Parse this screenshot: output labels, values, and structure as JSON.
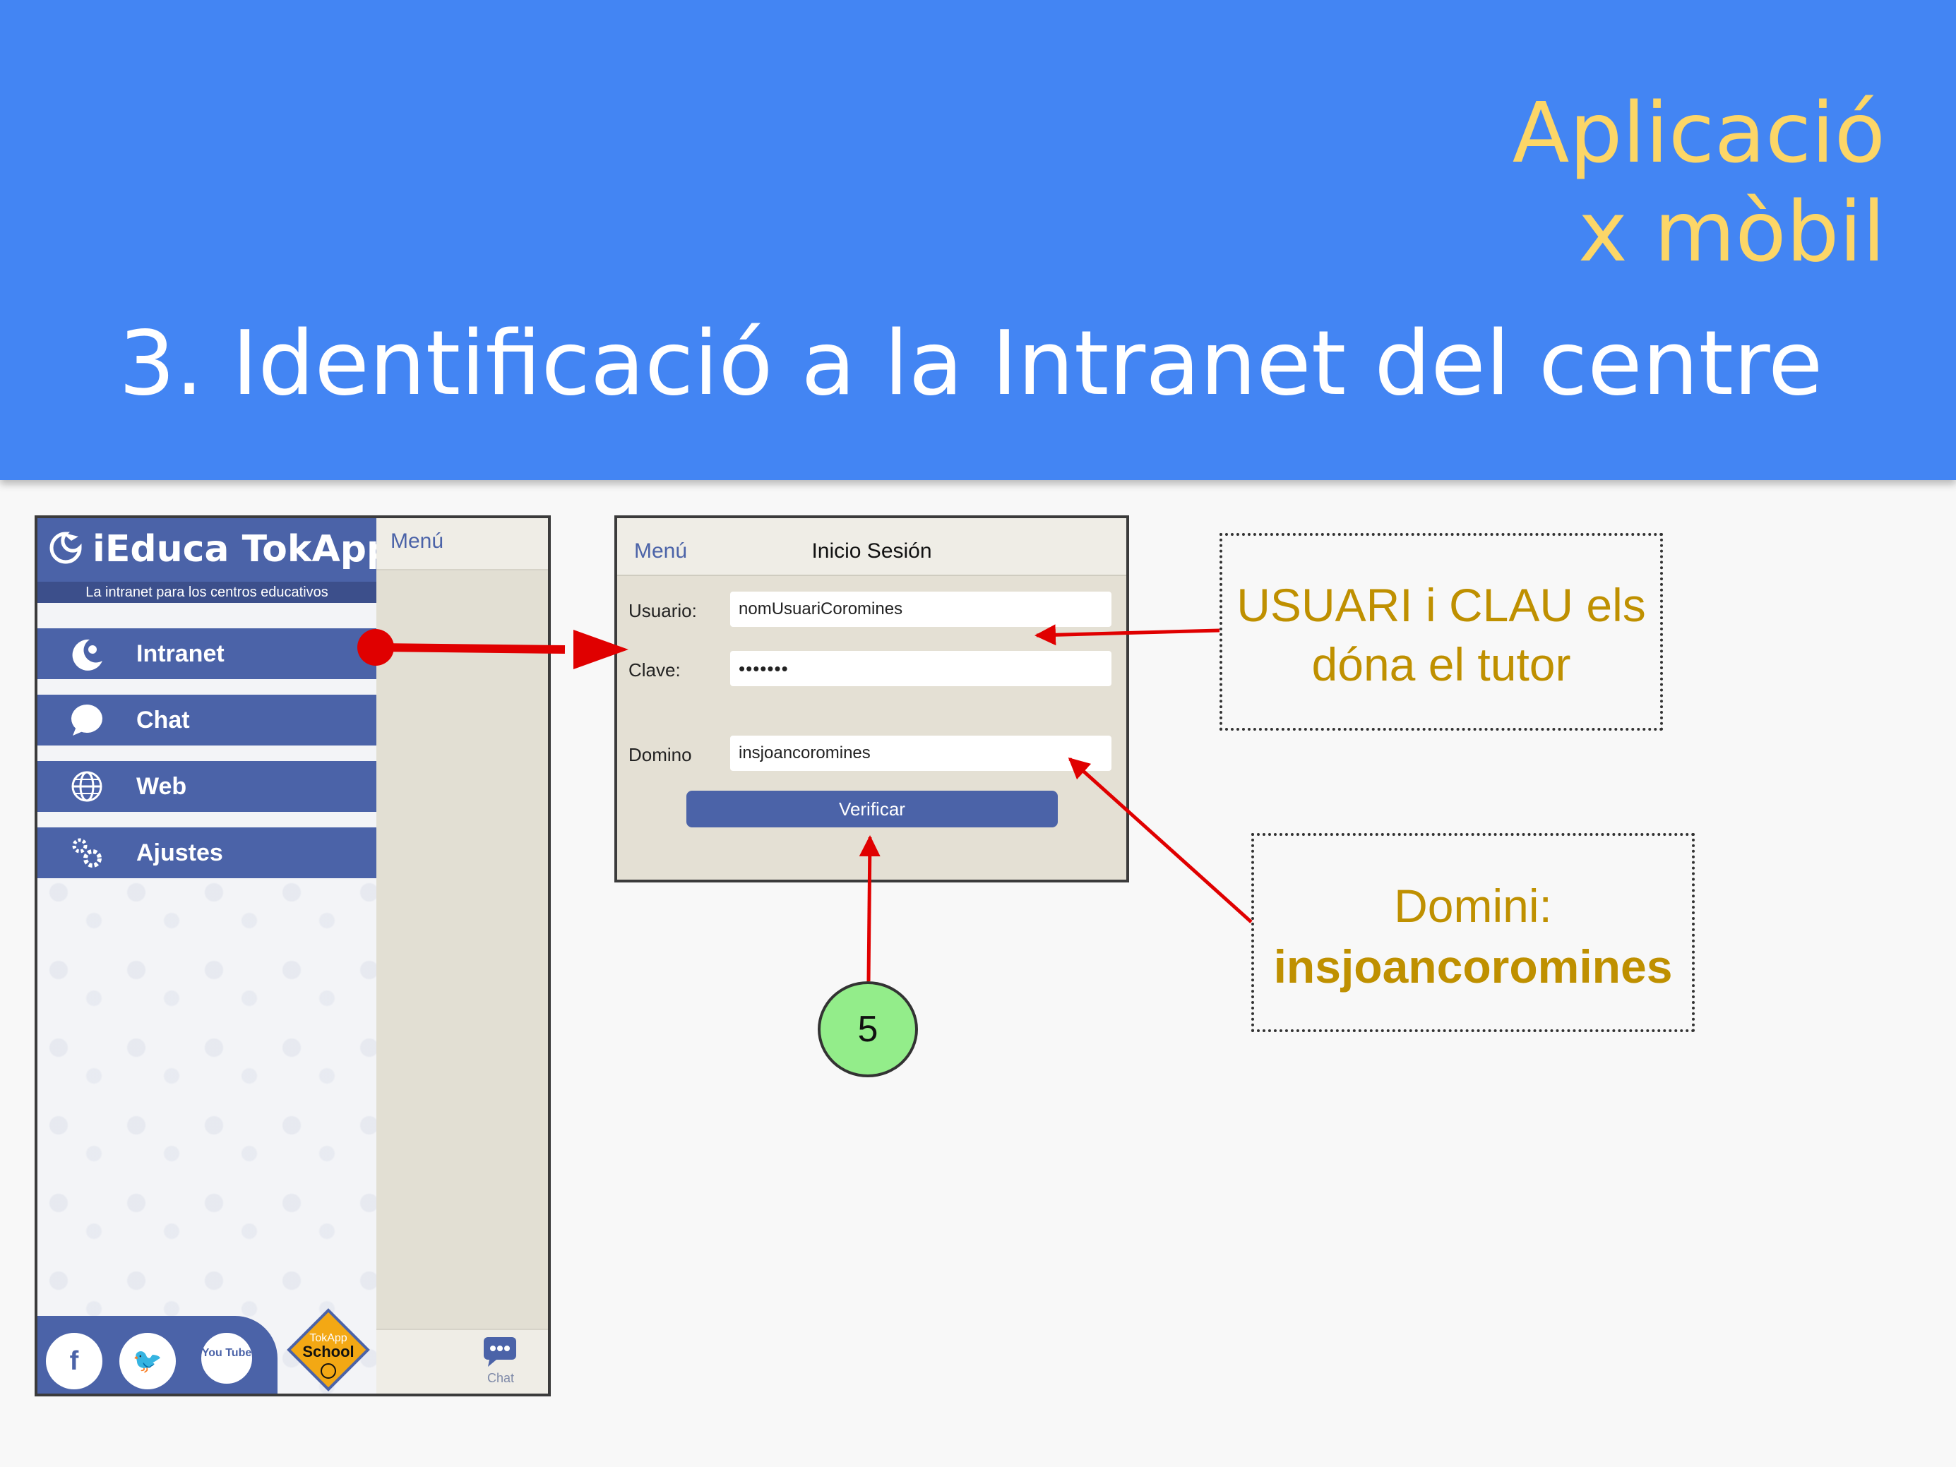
{
  "slide": {
    "app_title_line1": "Aplicació",
    "app_title_line2": "x mòbil",
    "title": "3. Identificació a la Intranet del centre"
  },
  "app_menu": {
    "brand_name": "iEduca TokApp",
    "tagline": "La intranet para los centros educativos",
    "items": [
      {
        "label": "Intranet",
        "icon": "moon-logo-icon"
      },
      {
        "label": "Chat",
        "icon": "chat-bubble-icon"
      },
      {
        "label": "Web",
        "icon": "globe-icon"
      },
      {
        "label": "Ajustes",
        "icon": "gears-icon"
      }
    ],
    "top_link": "Menú",
    "bottom_chat_label": "Chat",
    "social": [
      {
        "name": "facebook-icon",
        "glyph": "f"
      },
      {
        "name": "twitter-icon",
        "glyph": "🐦"
      },
      {
        "name": "youtube-icon",
        "glyph": "You Tube"
      }
    ],
    "school_badge_top": "TokApp",
    "school_badge_main": "School"
  },
  "login": {
    "nav_back": "Menú",
    "nav_title": "Inicio Sesión",
    "user_label": "Usuario:",
    "user_value": "nomUsuariCoromines",
    "password_label": "Clave:",
    "password_value": "•••••••",
    "domain_label": "Domino",
    "domain_value": "insjoancoromines",
    "verify_button": "Verificar"
  },
  "callouts": {
    "credentials_line1": "USUARI i CLAU els",
    "credentials_line2": "dóna el tutor",
    "domain_line1": "Domini:",
    "domain_line2": "insjoancoromines"
  },
  "step": "5",
  "colors": {
    "header_blue": "#4385f3",
    "title_yellow": "#fcd667",
    "callout_text": "#bf9000",
    "menu_blue": "#4b63a8",
    "arrow_red": "#e00000",
    "badge_green": "#93ed8a"
  }
}
